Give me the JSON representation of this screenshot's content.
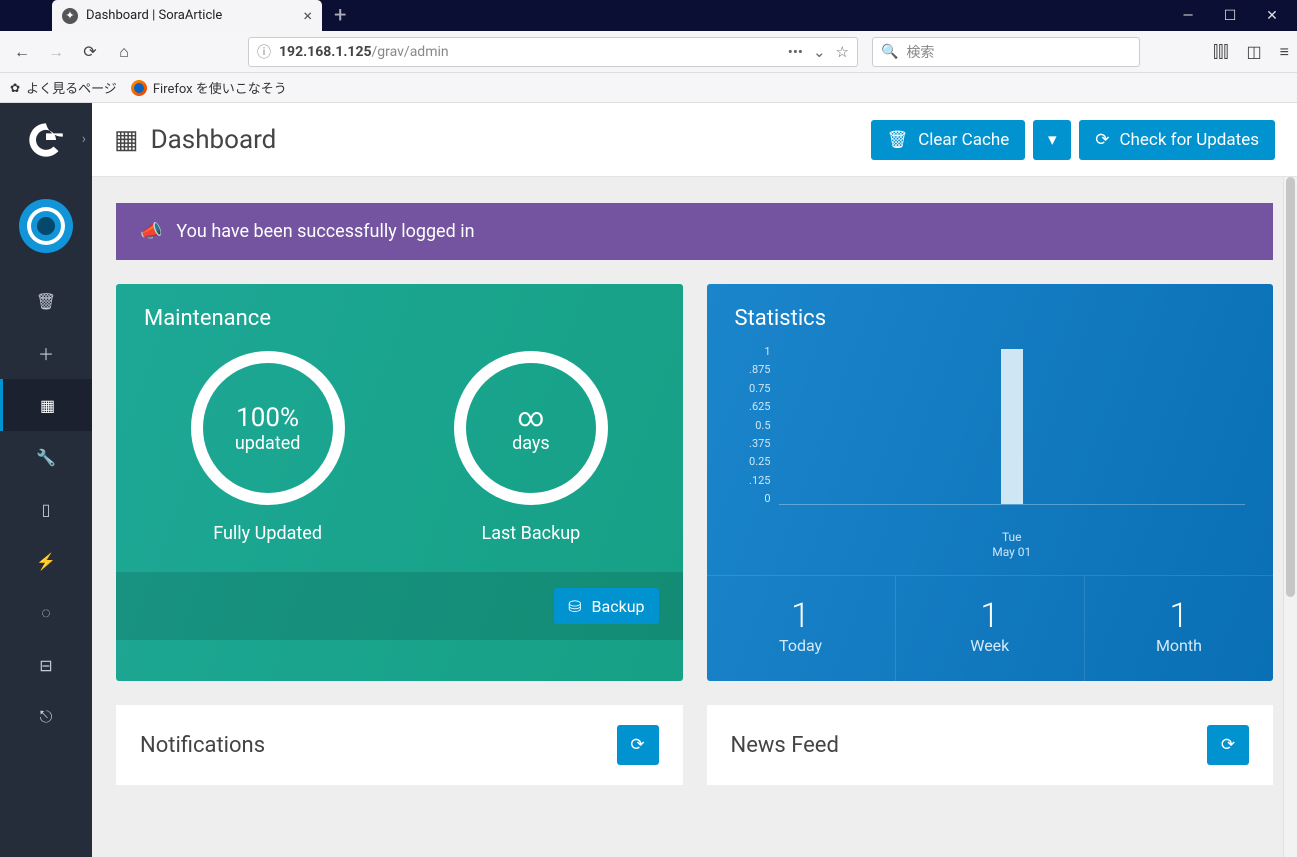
{
  "browser": {
    "tab_title": "Dashboard | SoraArticle",
    "url_prefix": "192.168.1.125",
    "url_path": "/grav/admin",
    "search_placeholder": "検索",
    "bookmarks": {
      "frequent": "よく見るページ",
      "firefox_guide": "Firefox を使いこなそう"
    }
  },
  "page": {
    "title": "Dashboard",
    "clear_cache": "Clear Cache",
    "check_updates": "Check for Updates"
  },
  "alert": {
    "message": "You have been successfully logged in"
  },
  "maintenance": {
    "title": "Maintenance",
    "updated_pct": "100%",
    "updated_label": "updated",
    "updated_caption": "Fully Updated",
    "backup_value": "∞",
    "backup_unit": "days",
    "backup_caption": "Last Backup",
    "backup_button": "Backup"
  },
  "statistics": {
    "title": "Statistics",
    "today_value": "1",
    "today_label": "Today",
    "week_value": "1",
    "week_label": "Week",
    "month_value": "1",
    "month_label": "Month"
  },
  "chart_data": {
    "type": "bar",
    "categories": [
      "Tue May 01"
    ],
    "values": [
      1
    ],
    "y_ticks": [
      "1",
      ".875",
      "0.75",
      ".625",
      "0.5",
      ".375",
      "0.25",
      ".125",
      "0"
    ],
    "ylim": [
      0,
      1
    ]
  },
  "panels": {
    "notifications": "Notifications",
    "news_feed": "News Feed"
  }
}
